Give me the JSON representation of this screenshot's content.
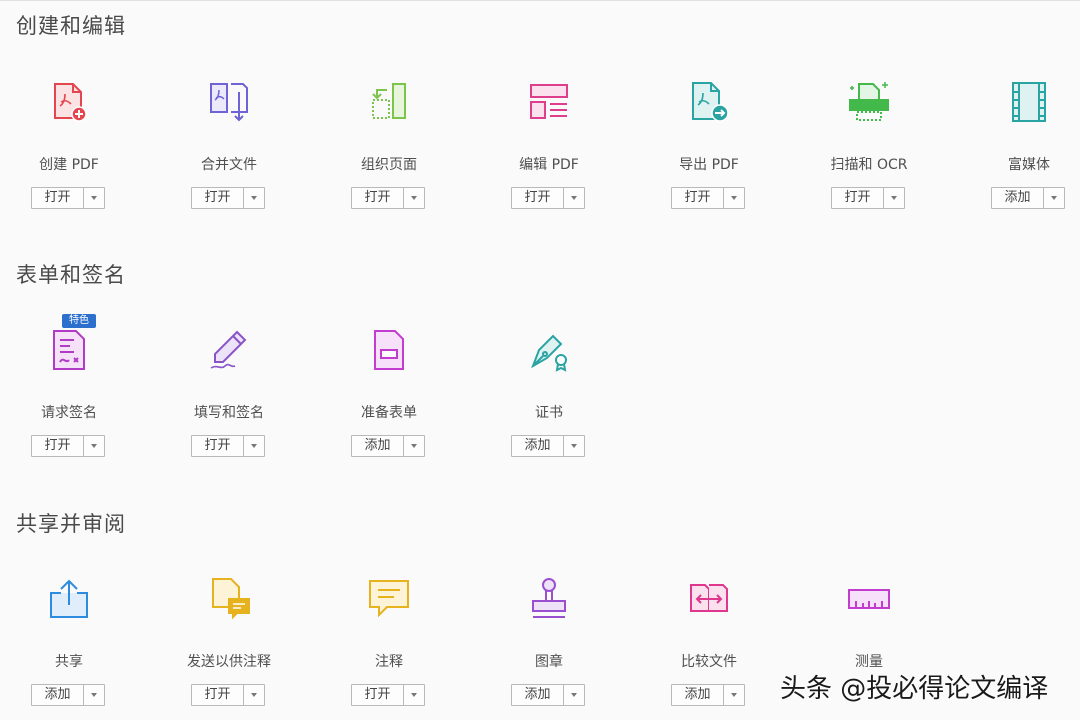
{
  "sections": [
    {
      "title": "创建和编辑",
      "tools": [
        {
          "label": "创建 PDF",
          "button": "打开",
          "icon": "create-pdf-icon"
        },
        {
          "label": "合并文件",
          "button": "打开",
          "icon": "combine-files-icon"
        },
        {
          "label": "组织页面",
          "button": "打开",
          "icon": "organize-pages-icon"
        },
        {
          "label": "编辑 PDF",
          "button": "打开",
          "icon": "edit-pdf-icon"
        },
        {
          "label": "导出 PDF",
          "button": "打开",
          "icon": "export-pdf-icon"
        },
        {
          "label": "扫描和 OCR",
          "button": "打开",
          "icon": "scan-ocr-icon"
        },
        {
          "label": "富媒体",
          "button": "添加",
          "icon": "rich-media-icon"
        }
      ]
    },
    {
      "title": "表单和签名",
      "tools": [
        {
          "label": "请求签名",
          "button": "打开",
          "icon": "request-signature-icon",
          "badge": "特色"
        },
        {
          "label": "填写和签名",
          "button": "打开",
          "icon": "fill-sign-icon"
        },
        {
          "label": "准备表单",
          "button": "添加",
          "icon": "prepare-form-icon"
        },
        {
          "label": "证书",
          "button": "添加",
          "icon": "certificates-icon"
        }
      ]
    },
    {
      "title": "共享并审阅",
      "tools": [
        {
          "label": "共享",
          "button": "添加",
          "icon": "share-icon"
        },
        {
          "label": "发送以供注释",
          "button": "打开",
          "icon": "send-for-comments-icon"
        },
        {
          "label": "注释",
          "button": "打开",
          "icon": "comment-icon"
        },
        {
          "label": "图章",
          "button": "添加",
          "icon": "stamp-icon"
        },
        {
          "label": "比较文件",
          "button": "添加",
          "icon": "compare-files-icon"
        },
        {
          "label": "测量",
          "button": "",
          "icon": "measure-icon"
        }
      ]
    }
  ],
  "watermark": "头条 @投必得论文编译",
  "colors": {
    "create": "#e5454f",
    "combine": "#6f64d6",
    "organize": "#7cc44a",
    "edit": "#de3f8c",
    "export": "#2aa3a3",
    "scan": "#43b94b",
    "media": "#2aa3a3",
    "sign": "#b03cc6",
    "fill": "#8a54c8",
    "form": "#c23ccf",
    "cert": "#2aa3a3",
    "share": "#2d8ce0",
    "send": "#e6b21e",
    "comment": "#e6b21e",
    "stamp": "#9a4fd1",
    "compare": "#e0378e",
    "measure": "#c23ccf",
    "badge": "#2d6fcd"
  }
}
